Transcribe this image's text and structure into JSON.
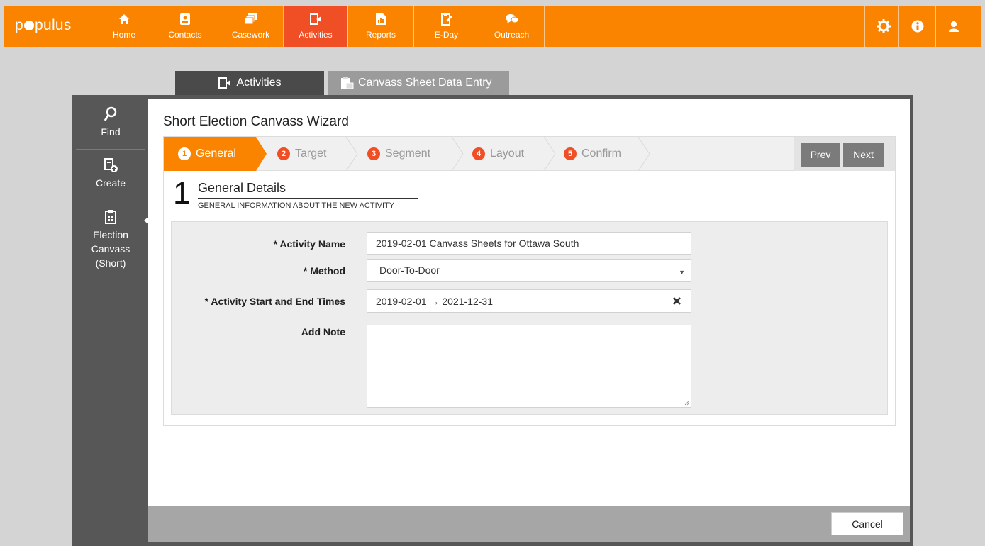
{
  "app": {
    "logo": "populus"
  },
  "nav": [
    {
      "label": "Home",
      "icon": "home-icon"
    },
    {
      "label": "Contacts",
      "icon": "contacts-icon"
    },
    {
      "label": "Casework",
      "icon": "casework-icon"
    },
    {
      "label": "Activities",
      "icon": "activities-icon",
      "active": true
    },
    {
      "label": "Reports",
      "icon": "reports-icon"
    },
    {
      "label": "E-Day",
      "icon": "eday-icon"
    },
    {
      "label": "Outreach",
      "icon": "outreach-icon"
    }
  ],
  "right_nav": [
    "settings-icon",
    "info-icon",
    "user-icon"
  ],
  "tabs": [
    {
      "label": "Activities",
      "active": true
    },
    {
      "label": "Canvass Sheet Data Entry"
    }
  ],
  "sidebar": {
    "items": [
      {
        "label": "Find",
        "icon": "search-icon"
      },
      {
        "label": "Create",
        "icon": "create-icon"
      },
      {
        "label": "Election Canvass (Short)",
        "label_lines": [
          "Election",
          "Canvass",
          "(Short)"
        ],
        "icon": "clipboard-icon",
        "active": true
      }
    ]
  },
  "wizard": {
    "title": "Short Election Canvass Wizard",
    "steps": [
      {
        "num": "1",
        "label": "General",
        "active": true
      },
      {
        "num": "2",
        "label": "Target"
      },
      {
        "num": "3",
        "label": "Segment"
      },
      {
        "num": "4",
        "label": "Layout"
      },
      {
        "num": "5",
        "label": "Confirm"
      }
    ],
    "prev_label": "Prev",
    "next_label": "Next",
    "section": {
      "number": "1",
      "title": "General Details",
      "subtitle": "GENERAL INFORMATION ABOUT THE NEW ACTIVITY"
    },
    "form": {
      "activity_name_label": "* Activity Name",
      "activity_name_value": "2019-02-01 Canvass Sheets for Ottawa South",
      "method_label": "* Method",
      "method_value": "Door-To-Door",
      "times_label": "* Activity Start and End Times",
      "times_value": "2019-02-01 → 2021-12-31",
      "note_label": "Add Note",
      "note_value": ""
    }
  },
  "footer": {
    "cancel_label": "Cancel"
  },
  "colors": {
    "accent": "#fa8300",
    "active_nav": "#f04e25",
    "dark": "#575757"
  }
}
